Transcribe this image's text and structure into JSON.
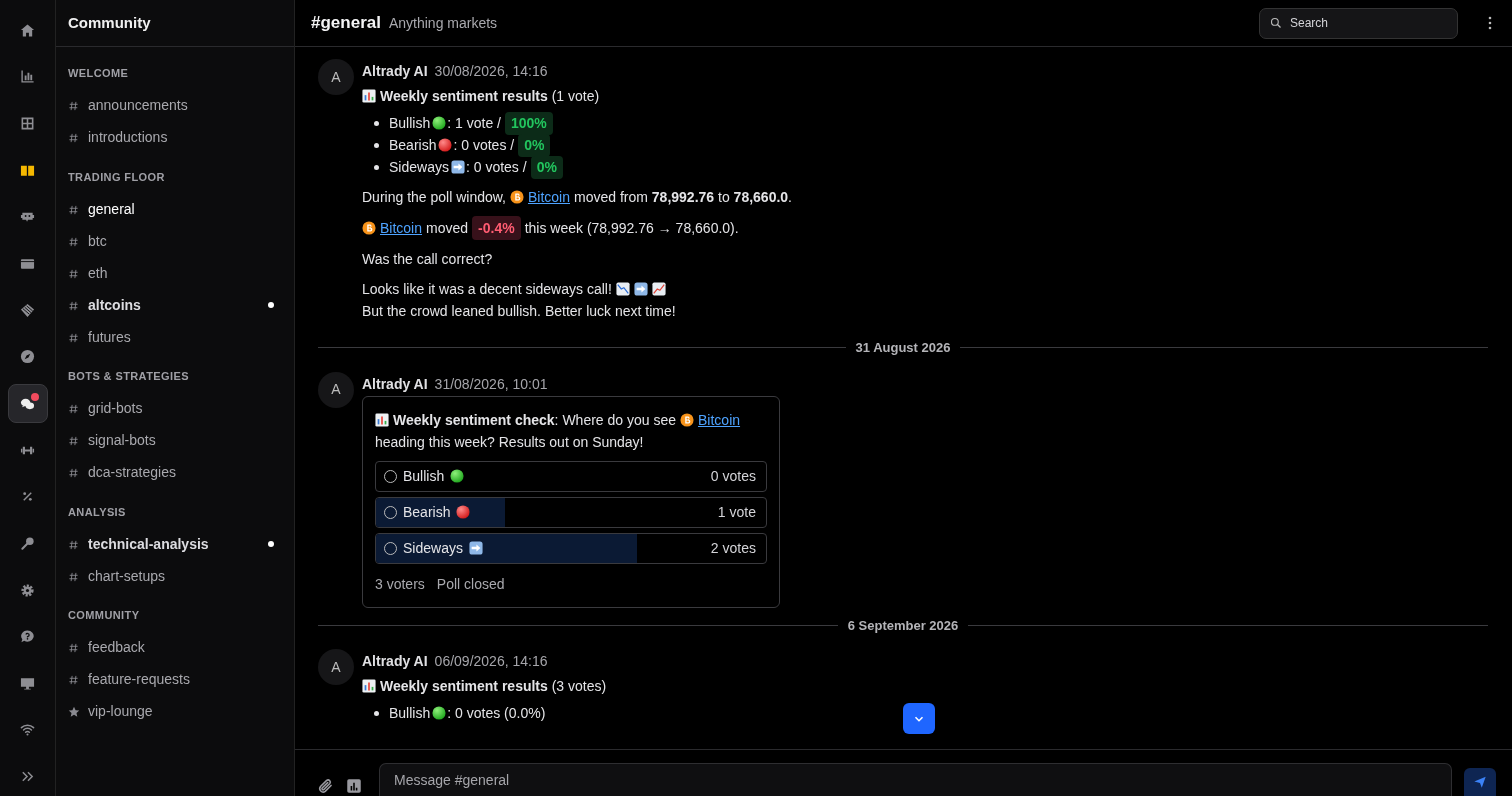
{
  "rail": [
    {
      "selected": false,
      "notification": false
    },
    {
      "selected": false,
      "notification": false
    },
    {
      "selected": false,
      "notification": false
    },
    {
      "selected": false,
      "notification": false
    },
    {
      "selected": false,
      "notification": false
    },
    {
      "selected": false,
      "notification": false
    },
    {
      "selected": false,
      "notification": false
    },
    {
      "selected": false,
      "notification": false
    },
    {
      "selected": true,
      "notification": true
    },
    {
      "selected": false,
      "notification": false
    },
    {
      "selected": false,
      "notification": false
    },
    {
      "selected": false,
      "notification": false
    },
    {
      "selected": false,
      "notification": false
    },
    {
      "selected": false,
      "notification": false
    },
    {
      "selected": false,
      "notification": false
    },
    {
      "selected": false,
      "notification": false
    },
    {
      "selected": false,
      "notification": false
    }
  ],
  "sidebar": {
    "title": "Community",
    "sections": [
      {
        "title": "WELCOME",
        "channels": [
          {
            "kind": "hash",
            "name": "announcements",
            "selected": false,
            "unread": false
          },
          {
            "kind": "hash",
            "name": "introductions",
            "selected": false,
            "unread": false
          }
        ]
      },
      {
        "title": "TRADING FLOOR",
        "channels": [
          {
            "kind": "hash",
            "name": "general",
            "selected": true,
            "unread": false
          },
          {
            "kind": "hash",
            "name": "btc",
            "selected": false,
            "unread": false
          },
          {
            "kind": "hash",
            "name": "eth",
            "selected": false,
            "unread": false
          },
          {
            "kind": "hash",
            "name": "altcoins",
            "selected": false,
            "unread": true
          },
          {
            "kind": "hash",
            "name": "futures",
            "selected": false,
            "unread": false
          }
        ]
      },
      {
        "title": "BOTS & STRATEGIES",
        "channels": [
          {
            "kind": "hash",
            "name": "grid-bots",
            "selected": false,
            "unread": false
          },
          {
            "kind": "hash",
            "name": "signal-bots",
            "selected": false,
            "unread": false
          },
          {
            "kind": "hash",
            "name": "dca-strategies",
            "selected": false,
            "unread": false
          }
        ]
      },
      {
        "title": "ANALYSIS",
        "channels": [
          {
            "kind": "hash",
            "name": "technical-analysis",
            "selected": false,
            "unread": true
          },
          {
            "kind": "hash",
            "name": "chart-setups",
            "selected": false,
            "unread": false
          }
        ]
      },
      {
        "title": "COMMUNITY",
        "channels": [
          {
            "kind": "hash",
            "name": "feedback",
            "selected": false,
            "unread": false
          },
          {
            "kind": "hash",
            "name": "feature-requests",
            "selected": false,
            "unread": false
          },
          {
            "kind": "star",
            "name": "vip-lounge",
            "selected": false,
            "unread": false
          }
        ]
      }
    ]
  },
  "header": {
    "channel": "#general",
    "topic": "Anything markets",
    "search": {
      "placeholder": "Search"
    }
  },
  "feed": [
    {
      "kind": "message",
      "avatar": "A",
      "author": "Altrady AI",
      "time": "30/08/2026, 14:16",
      "blocks": [
        {
          "kind": "title",
          "text": "**Weekly sentiment results** (1 vote)"
        },
        {
          "kind": "results",
          "items": [
            {
              "kind": "bull",
              "label": "Bullish",
              "text": ": 1 vote /",
              "pill": "100%",
              "negative": false
            },
            {
              "kind": "bear",
              "label": "Bearish",
              "text": ": 0 votes /",
              "pill": "0%",
              "negative": false
            },
            {
              "kind": "side",
              "label": "Sideways",
              "text": ": 0 votes /",
              "pill": "0%",
              "negative": false
            }
          ]
        },
        {
          "kind": "para",
          "segments": [
            {
              "kind": "text",
              "text": "During the poll window,"
            },
            {
              "kind": "coin"
            },
            {
              "kind": "link",
              "text": "Bitcoin"
            },
            {
              "kind": "text",
              "text": "moved from **78,992.76** to **78,660.0**."
            }
          ]
        },
        {
          "kind": "para",
          "segments": [
            {
              "kind": "coin"
            },
            {
              "kind": "link",
              "text": "Bitcoin"
            },
            {
              "kind": "text",
              "text": "moved"
            },
            {
              "kind": "pill",
              "text": "-0.4%",
              "negative": true
            },
            {
              "kind": "text",
              "text": "this week (78,992.76 → 78,660.0)."
            }
          ]
        },
        {
          "kind": "para",
          "segments": [
            {
              "kind": "text",
              "text": "Was the call correct?"
            }
          ]
        },
        {
          "kind": "line",
          "segments": [
            {
              "kind": "text",
              "text": "Looks like it was a decent sideways call!"
            },
            {
              "kind": "fall"
            },
            {
              "kind": "side"
            },
            {
              "kind": "rise"
            }
          ]
        },
        {
          "kind": "para",
          "segments": [
            {
              "kind": "text",
              "text": "But the crowd leaned bullish. Better luck next time!"
            }
          ]
        }
      ]
    },
    {
      "kind": "divider",
      "label": "31 August 2026"
    },
    {
      "kind": "message",
      "avatar": "A",
      "author": "Altrady AI",
      "time": "31/08/2026, 10:01",
      "blocks": [
        {
          "kind": "poll",
          "segments": [
            {
              "kind": "text",
              "text": "**Weekly sentiment check**: Where do you see"
            },
            {
              "kind": "coin"
            },
            {
              "kind": "link",
              "text": "Bitcoin"
            },
            {
              "kind": "text",
              "text": "heading this week? Results out on Sunday!"
            }
          ],
          "options": [
            {
              "kind": "bull",
              "label": "Bullish",
              "votes": "0 votes",
              "level": 0,
              "selected": false
            },
            {
              "kind": "bear",
              "label": "Bearish",
              "votes": "1 vote",
              "level": 0.33,
              "selected": false
            },
            {
              "kind": "side",
              "label": "Sideways",
              "votes": "2 votes",
              "level": 0.67,
              "selected": false
            }
          ],
          "footer": [
            "3 voters",
            "Poll closed"
          ]
        }
      ]
    },
    {
      "kind": "divider",
      "label": "6 September 2026"
    },
    {
      "kind": "message",
      "avatar": "A",
      "author": "Altrady AI",
      "time": "06/09/2026, 14:16",
      "blocks": [
        {
          "kind": "title",
          "text": "**Weekly sentiment results** (3 votes)"
        },
        {
          "kind": "results",
          "items": [
            {
              "kind": "bull",
              "label": "Bullish",
              "text": ": 0 votes (0.0%)"
            }
          ]
        }
      ]
    }
  ],
  "composer": {
    "placeholder": "Message #general"
  }
}
